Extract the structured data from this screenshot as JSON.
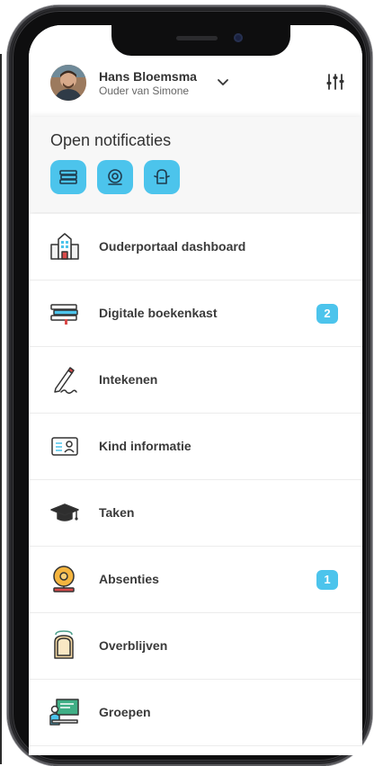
{
  "user": {
    "name": "Hans Bloemsma",
    "role": "Ouder van Simone"
  },
  "notifications": {
    "title": "Open notificaties",
    "buttons": [
      {
        "icon": "books-icon"
      },
      {
        "icon": "alarm-bell-icon"
      },
      {
        "icon": "sandwich-icon"
      }
    ]
  },
  "menu": [
    {
      "label": "Ouderportaal dashboard",
      "icon": "school-building-icon",
      "badge": ""
    },
    {
      "label": "Digitale boekenkast",
      "icon": "books-icon",
      "badge": "2"
    },
    {
      "label": "Intekenen",
      "icon": "pen-signature-icon",
      "badge": ""
    },
    {
      "label": "Kind informatie",
      "icon": "id-card-icon",
      "badge": ""
    },
    {
      "label": "Taken",
      "icon": "graduation-cap-icon",
      "badge": ""
    },
    {
      "label": "Absenties",
      "icon": "alarm-bell-icon",
      "badge": "1"
    },
    {
      "label": "Overblijven",
      "icon": "lunch-icon",
      "badge": ""
    },
    {
      "label": "Groepen",
      "icon": "teacher-board-icon",
      "badge": ""
    }
  ],
  "colors": {
    "accent": "#4cc4ec",
    "text": "#3a3a3a",
    "notif_bg": "#f7f7f7"
  }
}
